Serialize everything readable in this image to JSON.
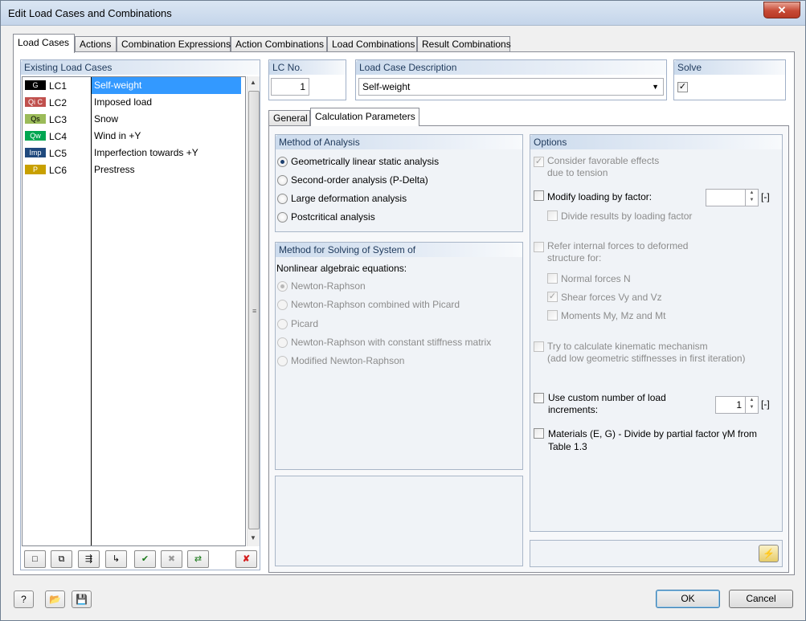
{
  "window": {
    "title": "Edit Load Cases and Combinations",
    "close_glyph": "✕"
  },
  "tabs": [
    {
      "label": "Load Cases",
      "active": true
    },
    {
      "label": "Actions"
    },
    {
      "label": "Combination Expressions"
    },
    {
      "label": "Action Combinations"
    },
    {
      "label": "Load Combinations"
    },
    {
      "label": "Result Combinations"
    }
  ],
  "existing": {
    "header": "Existing Load Cases",
    "items": [
      {
        "badge": "G",
        "badge_color": "#000000",
        "no": "LC1",
        "desc": "Self-weight",
        "selected": true
      },
      {
        "badge": "Qi C",
        "badge_color": "#c0504d",
        "no": "LC2",
        "desc": "Imposed load"
      },
      {
        "badge": "Qs",
        "badge_color": "#9bbb59",
        "no": "LC3",
        "desc": "Snow"
      },
      {
        "badge": "Qw",
        "badge_color": "#00a651",
        "no": "LC4",
        "desc": "Wind in +Y"
      },
      {
        "badge": "Imp",
        "badge_color": "#1f497d",
        "no": "LC5",
        "desc": "Imperfection towards +Y"
      },
      {
        "badge": "P",
        "badge_color": "#c8a000",
        "no": "LC6",
        "desc": "Prestress"
      }
    ]
  },
  "list_toolbar": [
    {
      "icon": "new-load-case-icon",
      "glyph": "□"
    },
    {
      "icon": "copy-load-case-icon",
      "glyph": "⧉"
    },
    {
      "icon": "generate-icon",
      "glyph": "⇶"
    },
    {
      "icon": "renumber-icon",
      "glyph": "↳"
    },
    {
      "icon": "check-all-icon",
      "glyph": "✔"
    },
    {
      "icon": "uncheck-icon",
      "glyph": "✖"
    },
    {
      "icon": "export-icon",
      "glyph": "⇄"
    },
    {
      "icon": "delete-icon",
      "glyph": "✘"
    }
  ],
  "lc_no": {
    "label": "LC No.",
    "value": "1"
  },
  "lc_desc": {
    "label": "Load Case Description",
    "value": "Self-weight"
  },
  "solve": {
    "label": "Solve",
    "checked": true
  },
  "inner_tabs": [
    {
      "label": "General"
    },
    {
      "label": "Calculation Parameters",
      "active": true
    }
  ],
  "method_analysis": {
    "header": "Method of Analysis",
    "options": [
      {
        "label": "Geometrically linear static analysis",
        "checked": true
      },
      {
        "label": "Second-order analysis (P-Delta)"
      },
      {
        "label": "Large deformation analysis"
      },
      {
        "label": "Postcritical analysis"
      }
    ]
  },
  "method_solving": {
    "header": "Method for Solving of System of",
    "subheader": "Nonlinear algebraic equations:",
    "options": [
      {
        "label": "Newton-Raphson",
        "checked": true
      },
      {
        "label": "Newton-Raphson combined with Picard"
      },
      {
        "label": "Picard"
      },
      {
        "label": "Newton-Raphson with constant stiffness matrix"
      },
      {
        "label": "Modified Newton-Raphson"
      }
    ]
  },
  "options": {
    "header": "Options",
    "favorable_1": "Consider favorable effects",
    "favorable_2": "due to tension",
    "modify_loading": "Modify loading by factor:",
    "modify_unit": "[-]",
    "divide_results": "Divide results by loading factor",
    "refer_1": "Refer internal forces to deformed",
    "refer_2": "structure for:",
    "normal_forces": "Normal forces N",
    "shear_forces": "Shear forces Vy and Vz",
    "moments": "Moments My, Mz and Mt",
    "kinematic_1": "Try to calculate kinematic mechanism",
    "kinematic_2": "(add low geometric stiffnesses in first iteration)",
    "increments_1": "Use custom number of load",
    "increments_2": "increments:",
    "increments_value": "1",
    "increments_unit": "[-]",
    "materials_1": "Materials (E, G) - Divide by partial factor γM from",
    "materials_2": "Table 1.3"
  },
  "footer": {
    "ok": "OK",
    "cancel": "Cancel",
    "icons": [
      "help-icon",
      "open-icon",
      "save-icon"
    ]
  },
  "colors": {
    "selection": "#3399ff",
    "group_header_text": "#1e395b"
  }
}
